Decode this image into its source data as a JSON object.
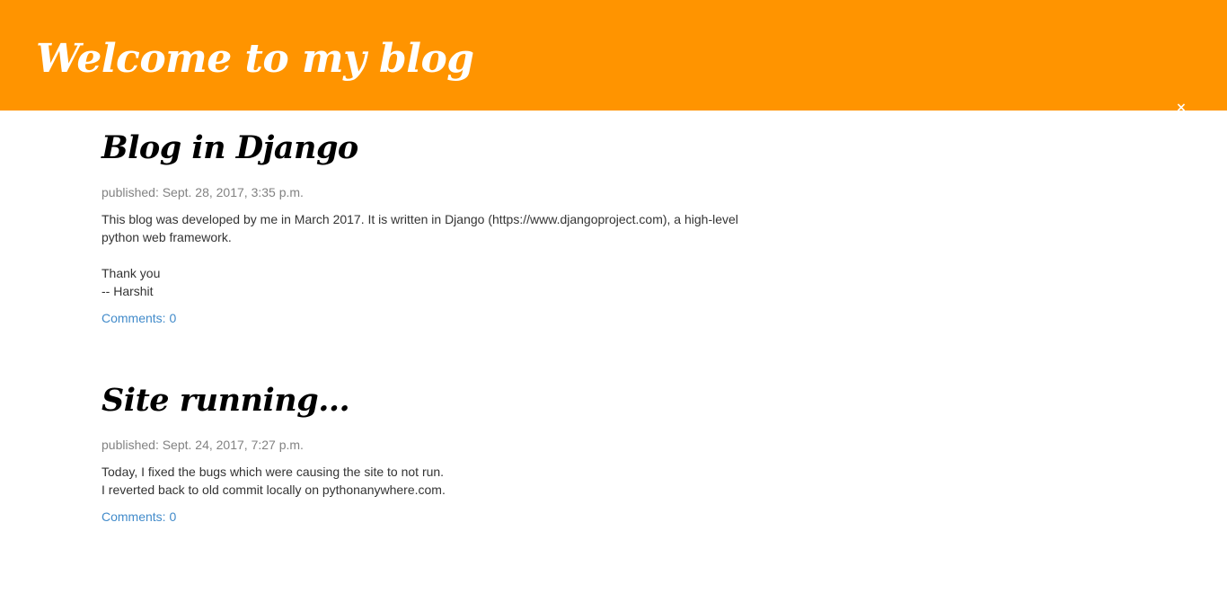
{
  "header": {
    "title": "Welcome to my blog",
    "close_glyph": "×",
    "background_color": "#ff9400"
  },
  "posts": [
    {
      "title": "Blog in Django",
      "published": "published: Sept. 28, 2017, 3:35 p.m.",
      "body_lines": [
        "This blog was developed by me in March 2017. It is written in Django (https://www.djangoproject.com), a high-level",
        "python web framework.",
        "",
        "Thank you",
        "-- Harshit"
      ],
      "comments": "Comments: 0"
    },
    {
      "title": "Site running...",
      "published": "published: Sept. 24, 2017, 7:27 p.m.",
      "body_lines": [
        "Today, I fixed the bugs which were causing the site to not run.",
        "I reverted back to old commit locally on pythonanywhere.com."
      ],
      "comments": "Comments: 0"
    }
  ],
  "colors": {
    "link": "#428bca",
    "date": "#828282",
    "text": "#333333"
  }
}
